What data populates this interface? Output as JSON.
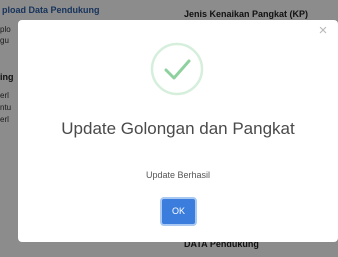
{
  "background": {
    "upload_title": "pload Data Pendukung",
    "jenis_label": "Jenis Kenaikan Pangkat (KP)",
    "left_line_1": "plo",
    "left_line_2": "gu",
    "left_heading": "ing",
    "left_line_3": "erl",
    "left_line_4": "ntu",
    "left_line_5": "erl",
    "data_pendukung": "DATA Pendukung"
  },
  "modal": {
    "close_glyph": "×",
    "success_icon": "check-circle-icon",
    "title": "Update Golongan dan Pangkat",
    "message": "Update Berhasil",
    "ok_label": "OK",
    "accent_color": "#3b7ddd",
    "success_color": "#8fd19e"
  }
}
